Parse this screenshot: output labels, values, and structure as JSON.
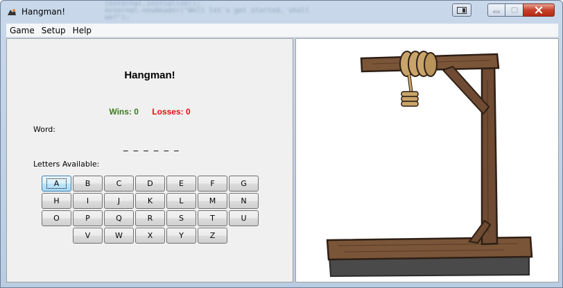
{
  "window": {
    "title": "Hangman!",
    "blurred_code_line1": "(external.initialize();",
    "blurred_code_line2": "external.neuHeader(\"Well let's get started, shall we?\");"
  },
  "menu": [
    "Game",
    "Setup",
    "Help"
  ],
  "game": {
    "title": "Hangman!",
    "wins_label": "Wins: 0",
    "losses_label": "Losses: 0",
    "word_label": "Word:",
    "word_value": "_ _ _ _ _ _",
    "letters_label": "Letters Available:"
  },
  "letters": [
    [
      "A",
      "B",
      "C",
      "D",
      "E",
      "F",
      "G"
    ],
    [
      "H",
      "I",
      "J",
      "K",
      "L",
      "M",
      "N"
    ],
    [
      "O",
      "P",
      "Q",
      "R",
      "S",
      "T",
      "U"
    ],
    [
      "V",
      "W",
      "X",
      "Y",
      "Z"
    ]
  ],
  "focused_letter": "A",
  "colors": {
    "wins": "#3a7a1e",
    "losses": "#e01010",
    "wood": "#6b4a33",
    "wood_dark": "#3b2a1e",
    "base_shadow": "#4a4a4a"
  },
  "image": {
    "icon": "gallows-icon"
  }
}
